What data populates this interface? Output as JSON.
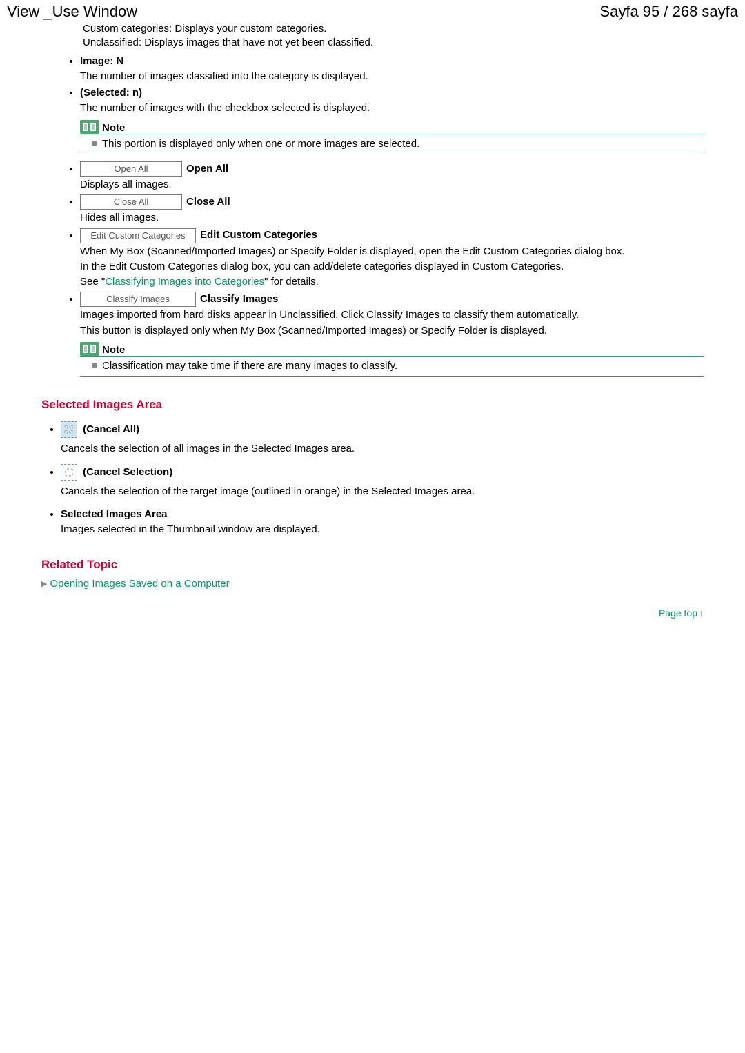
{
  "header": {
    "title_left": "View _Use Window",
    "title_right": "Sayfa 95 / 268 sayfa"
  },
  "intro": {
    "line1": "Custom categories: Displays your custom categories.",
    "line2": "Unclassified: Displays images that have not yet been classified."
  },
  "items": {
    "image_n": {
      "label": "Image: N",
      "desc": "The number of images classified into the category is displayed."
    },
    "selected_n": {
      "label": "(Selected: n)",
      "desc": "The number of images with the checkbox selected is displayed.",
      "note_title": "Note",
      "note_text": "This portion is displayed only when one or more images are selected."
    },
    "open_all": {
      "button": "Open All",
      "label": "Open All",
      "desc": "Displays all images."
    },
    "close_all": {
      "button": "Close All",
      "label": "Close All",
      "desc": "Hides all images."
    },
    "edit_custom": {
      "button": "Edit Custom Categories",
      "label": "Edit Custom Categories",
      "desc1": "When My Box (Scanned/Imported Images) or Specify Folder is displayed, open the Edit Custom Categories dialog box.",
      "desc2": "In the Edit Custom Categories dialog box, you can add/delete categories displayed in Custom Categories.",
      "see_prefix": "See \"",
      "see_link": "Classifying Images into Categories",
      "see_suffix": "\" for details."
    },
    "classify": {
      "button": "Classify Images",
      "label": "Classify Images",
      "desc1": "Images imported from hard disks appear in Unclassified. Click Classify Images to classify them automatically.",
      "desc2": "This button is displayed only when My Box (Scanned/Imported Images) or Specify Folder is displayed.",
      "note_title": "Note",
      "note_text": "Classification may take time if there are many images to classify."
    }
  },
  "selected_area": {
    "heading": "Selected Images Area",
    "cancel_all": {
      "label": " (Cancel All)",
      "desc": "Cancels the selection of all images in the Selected Images area."
    },
    "cancel_selection": {
      "label": " (Cancel Selection)",
      "desc": "Cancels the selection of the target image (outlined in orange) in the Selected Images area."
    },
    "area": {
      "label": "Selected Images Area",
      "desc": "Images selected in the Thumbnail window are displayed."
    }
  },
  "related": {
    "heading": "Related Topic",
    "link": "Opening Images Saved on a Computer"
  },
  "page_top": "Page top"
}
